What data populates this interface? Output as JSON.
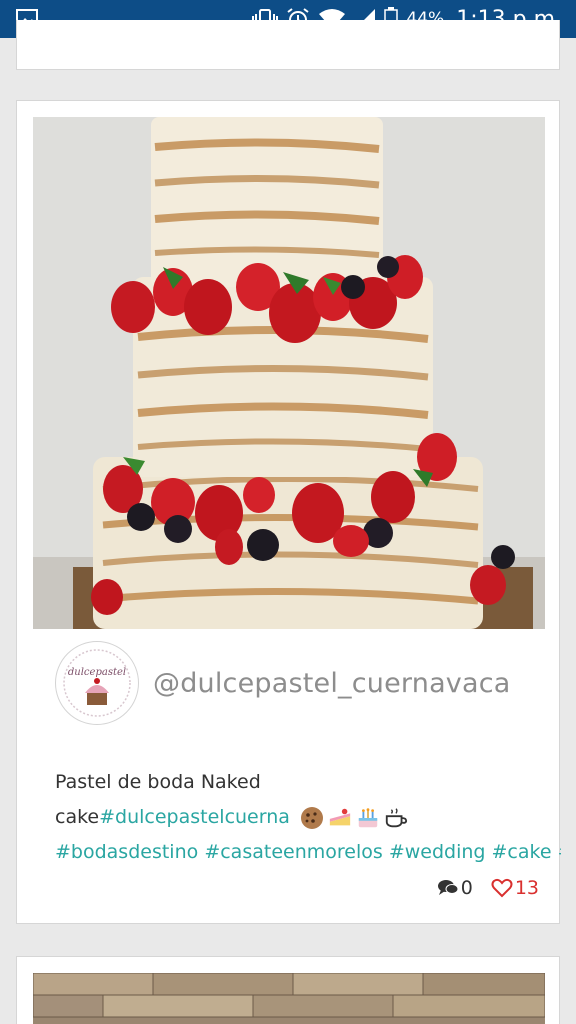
{
  "status_bar": {
    "battery_percent": "44%",
    "time": "1:13 p.m.",
    "icons": [
      "image-notification-icon",
      "vibrate-icon",
      "alarm-icon",
      "wifi-icon",
      "signal-icon",
      "battery-icon"
    ]
  },
  "post": {
    "username": "@dulcepastel_cuernavaca",
    "avatar_logo_text": "dulcepastel",
    "caption_text": "Pastel de boda Naked",
    "caption_text_2": "cake",
    "caption_tag_1": "#dulcepastelcuerna",
    "hashtags": [
      "#bodasdestino",
      "#casateenmorelos",
      "#wedding",
      "#cake",
      "#r"
    ],
    "emojis": [
      "cookie-icon",
      "cake-slice-icon",
      "birthday-cake-icon",
      "coffee-icon"
    ],
    "comments_count": "0",
    "likes_count": "13"
  },
  "colors": {
    "status_bar": "#0d4d87",
    "hashtag": "#2aa6a2",
    "like": "#d9302f",
    "username": "#8d8d8d"
  }
}
